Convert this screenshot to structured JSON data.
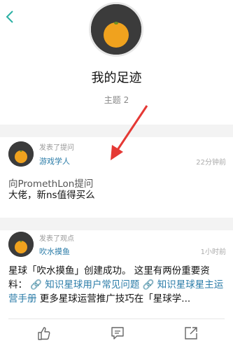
{
  "header": {
    "back_icon": "chevron-left-icon",
    "title": "我的足迹",
    "subtitle": "主题 2"
  },
  "posts": [
    {
      "action": "发表了提问",
      "author": "游戏学人",
      "time": "22分钟前",
      "line1": "向PromethLon提问",
      "line2": "大佬，新ns值得买么"
    },
    {
      "action": "发表了观点",
      "author": "吹水摸鱼",
      "time": "1小时前",
      "body_part1": "星球「吹水摸鱼」创建成功。 这里有两份重要资料：",
      "link1": "🔗 知识星球用户常见问题",
      "link2": "🔗 知识星球星主运营手册",
      "body_part2": " 更多星球运营推广技巧在「星球学..."
    }
  ],
  "actions": [
    {
      "name": "like-icon"
    },
    {
      "name": "comment-icon"
    },
    {
      "name": "share-icon"
    }
  ],
  "colors": {
    "accent": "#2bb0a4",
    "link": "#2b7ca8",
    "annotation_arrow": "#e53935"
  }
}
